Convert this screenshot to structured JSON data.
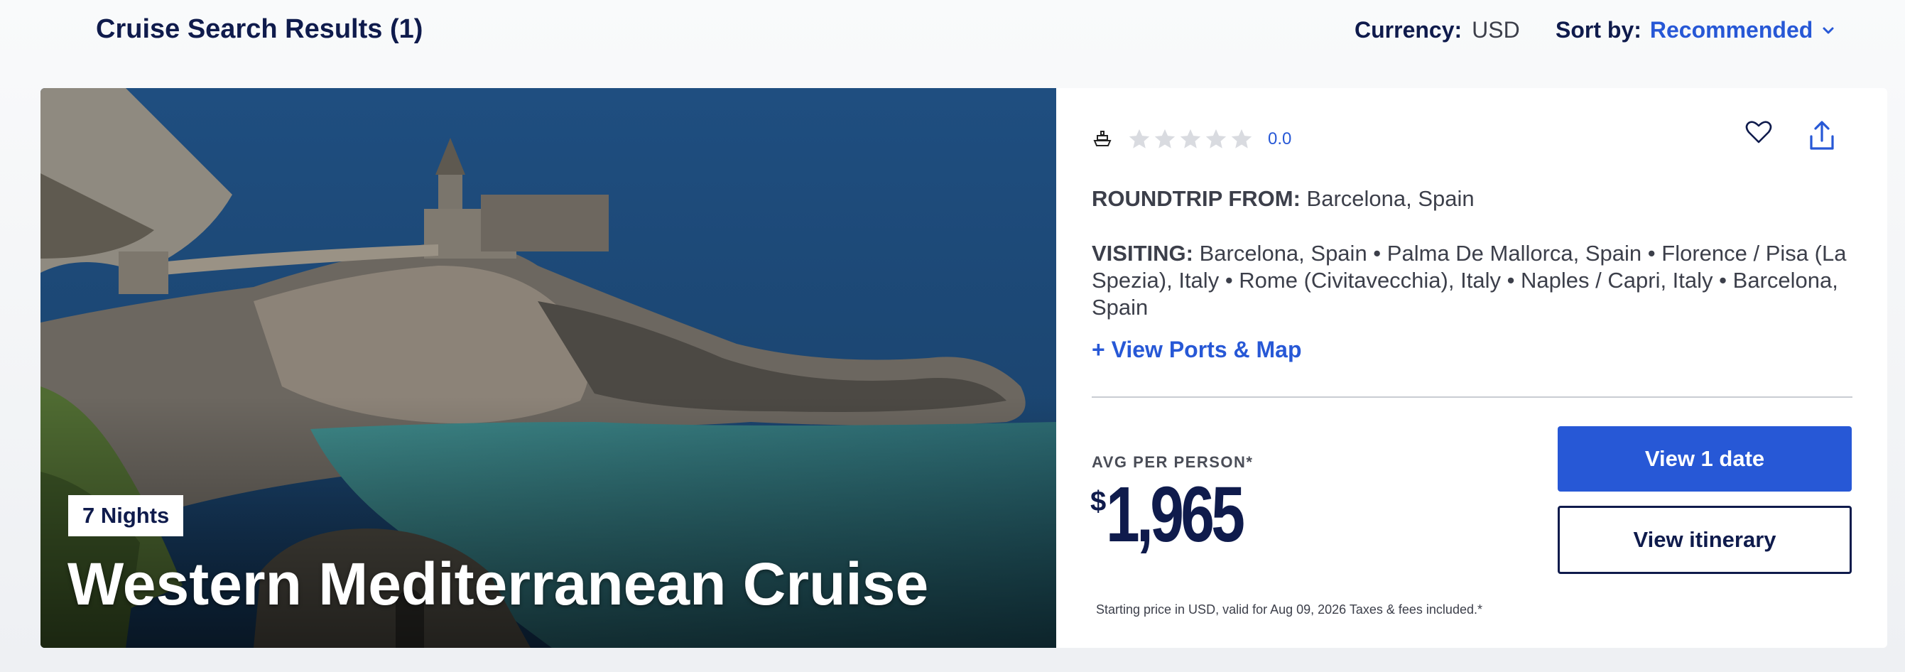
{
  "header": {
    "results_title": "Cruise Search Results (1)",
    "currency_label": "Currency:",
    "currency_value": "USD",
    "sort_label": "Sort by:",
    "sort_value": "Recommended"
  },
  "card": {
    "nights_badge": "7 Nights",
    "title": "Western Mediterranean Cruise",
    "rating": {
      "value": "0.0",
      "stars_filled": 0,
      "stars_total": 5
    },
    "roundtrip_label": "ROUNDTRIP FROM:",
    "roundtrip_value": "Barcelona, Spain",
    "visiting_label": "VISITING:",
    "visiting_ports": [
      "Barcelona, Spain",
      "Palma De Mallorca, Spain",
      "Florence / Pisa (La Spezia), Italy",
      "Rome (Civitavecchia), Italy",
      "Naples / Capri, Italy",
      "Barcelona, Spain"
    ],
    "view_ports_label": "+ View Ports & Map",
    "avg_label": "AVG PER PERSON*",
    "price_currency_symbol": "$",
    "price_amount": "1,965",
    "btn_view_dates": "View 1 date",
    "btn_view_itinerary": "View itinerary",
    "disclaimer": "Starting price in USD, valid for Aug 09, 2026 Taxes & fees included.*"
  },
  "icons": {
    "ship": "ship-icon",
    "star": "star-icon",
    "favorite": "heart-icon",
    "share": "share-icon",
    "sort_chevron": "chevron-down-icon"
  },
  "colors": {
    "accent": "#2758d6",
    "navy": "#0f1b4c",
    "star_empty": "#d9dbe0"
  }
}
